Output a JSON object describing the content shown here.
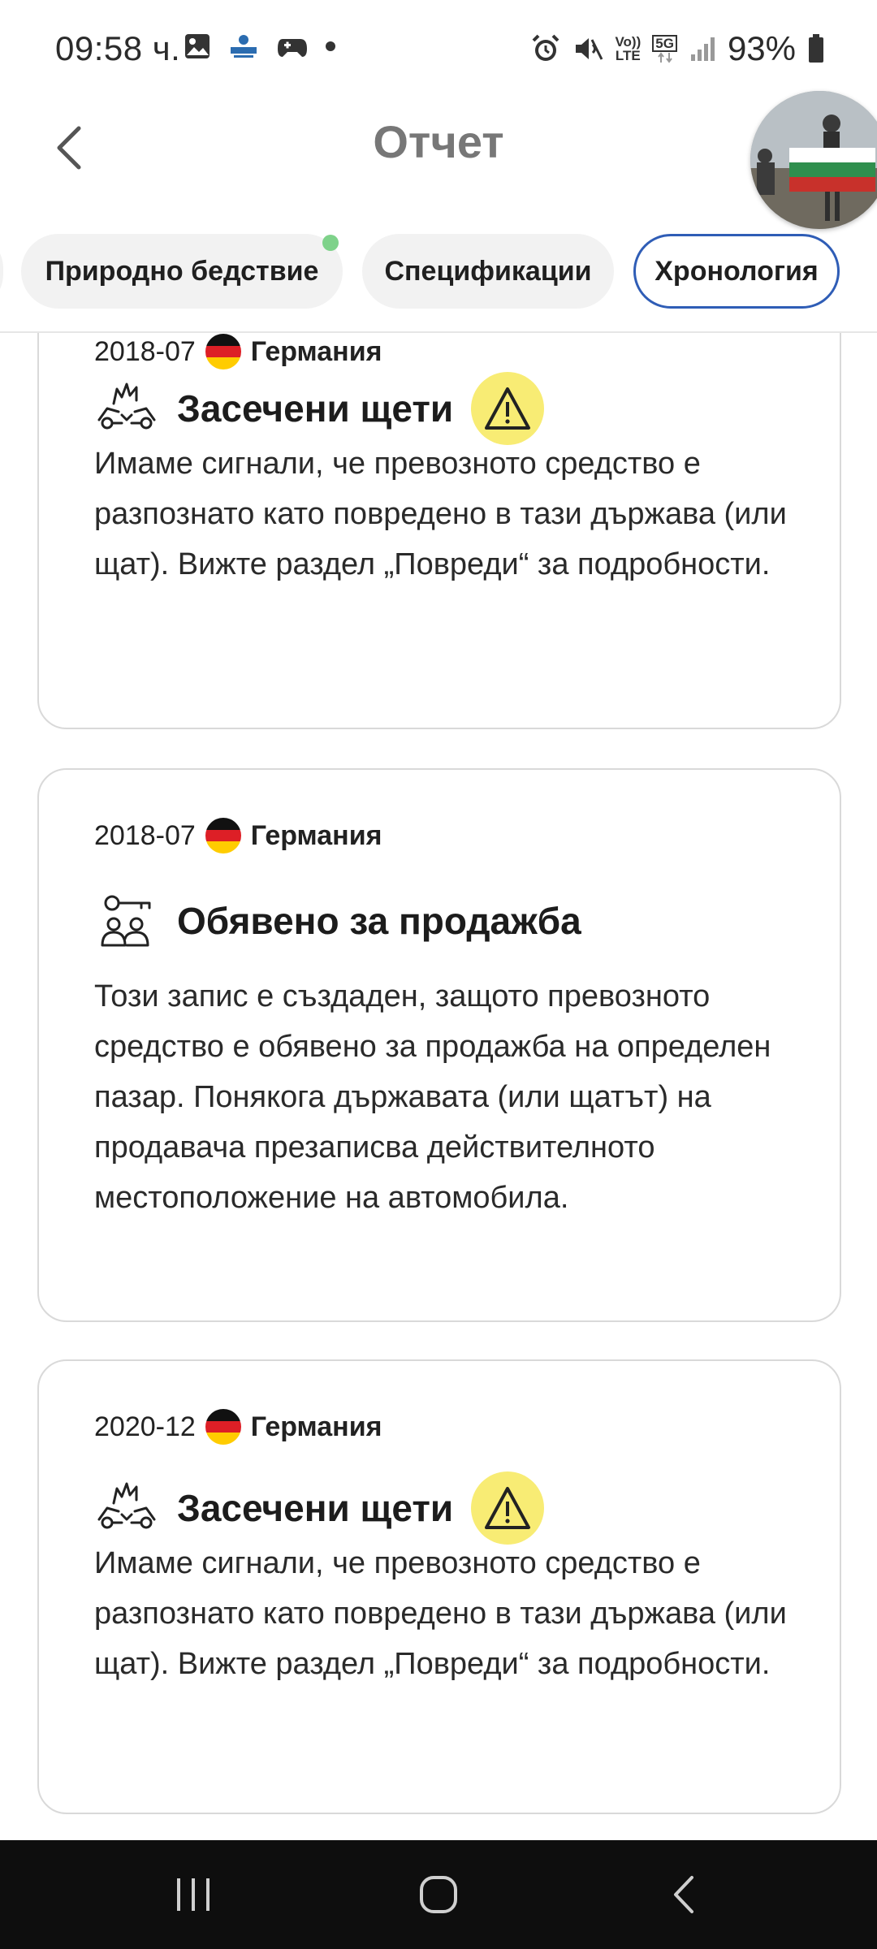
{
  "status_bar": {
    "time": "09:58 ч.",
    "network_top": "Vo))",
    "network_bottom": "LTE",
    "network_5g": "5G",
    "battery": "93%"
  },
  "header": {
    "title": "Отчет"
  },
  "tabs": [
    {
      "label": "Природно бедствие",
      "active": false,
      "has_dot": true
    },
    {
      "label": "Спецификации",
      "active": false
    },
    {
      "label": "Хронология",
      "active": true
    }
  ],
  "cards": [
    {
      "date": "2018-07",
      "country": "Германия",
      "title": "Засечени щети",
      "icon": "car-damage-icon",
      "warning": true,
      "description": "Имаме сигнали, че превозното средство е разпознато като повредено в тази държава (или щат). Вижте раздел „Повреди“ за подробности."
    },
    {
      "date": "2018-07",
      "country": "Германия",
      "title": "Обявено за продажба",
      "icon": "key-people-icon",
      "warning": false,
      "description": "Този запис е създаден, защото превозното средство е обявено за продажба на определен пазар. Понякога държавата (или щатът) на продавача презаписва действителното местоположение на автомобила."
    },
    {
      "date": "2020-12",
      "country": "Германия",
      "title": "Засечени щети",
      "icon": "car-damage-icon",
      "warning": true,
      "description": "Имаме сигнали, че превозното средство е разпознато като повредено в тази държава (или щат). Вижте раздел „Повреди“ за подробности."
    }
  ],
  "colors": {
    "active_tab_border": "#2f5db6",
    "warning_badge": "#f8ec74",
    "tab_dot": "#7ed28a",
    "title_gray": "#777777"
  }
}
